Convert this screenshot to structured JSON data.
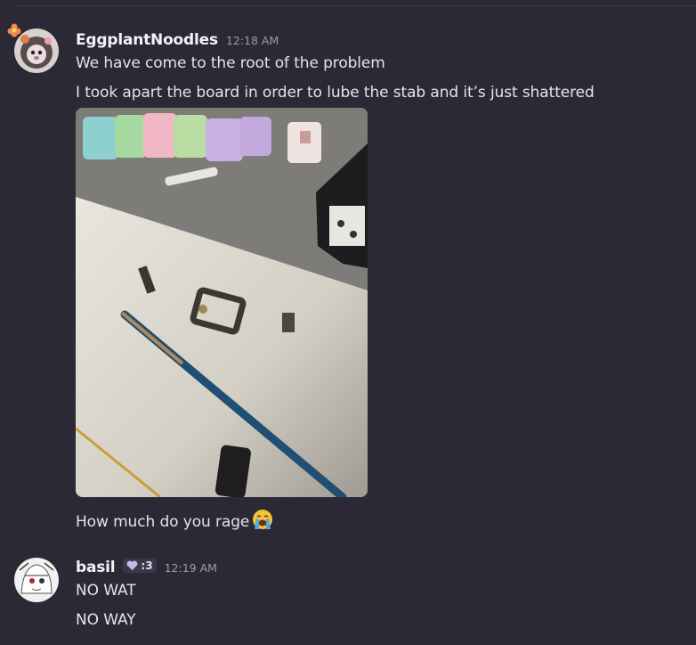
{
  "messages": [
    {
      "username": "EggplantNoodles",
      "timestamp": "12:18 AM",
      "lines": [
        "We have come to the root of the problem",
        "I took apart the board in order to lube the stab and it’s just shattered"
      ],
      "after_image_line": "How much do you rage",
      "emoji": "loudly-crying-face"
    },
    {
      "username": "basil",
      "badge": ":3",
      "badge_icon": "heart-icon",
      "timestamp": "12:19 AM",
      "lines": [
        "NO WAT",
        "NO WAY"
      ]
    }
  ],
  "colors": {
    "background": "#2a2935",
    "username": "#f2f3f5",
    "timestamp": "#9c9ca8",
    "text": "#e4e4ea"
  }
}
